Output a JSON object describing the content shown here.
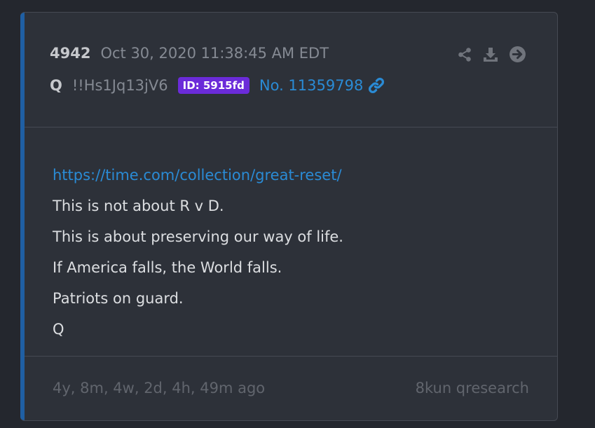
{
  "post": {
    "number": "4942",
    "date": "Oct 30, 2020 11:38:45 AM EDT",
    "author": "Q",
    "tripcode": "!!Hs1Jq13jV6",
    "id_badge": "ID: 5915fd",
    "post_link": "No. 11359798",
    "body": {
      "link": "https://time.com/collection/great-reset/",
      "lines": [
        "This is not about R v D.",
        "This is about preserving our way of life.",
        "If America falls, the World falls.",
        "Patriots on guard.",
        "Q"
      ]
    },
    "time_ago": "4y, 8m, 4w, 2d, 4h, 49m ago",
    "source": "8kun qresearch"
  },
  "icons": {
    "share": "share-icon",
    "download": "download-icon",
    "open": "arrow-circle-right-icon",
    "link": "link-icon"
  },
  "colors": {
    "background": "#24272e",
    "card": "#2d3139",
    "accent": "#1f5fa3",
    "link": "#2a8bd5",
    "id_badge": "#6b2bd9",
    "muted": "#858a93"
  }
}
